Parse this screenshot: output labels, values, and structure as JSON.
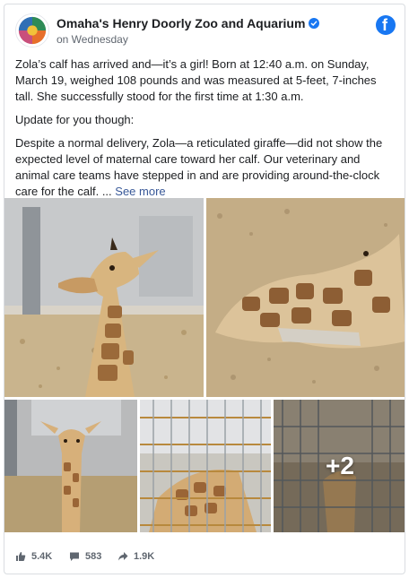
{
  "post": {
    "page_name": "Omaha's Henry Doorly Zoo and Aquarium",
    "timestamp": "on Wednesday",
    "paragraphs": [
      "Zola’s calf has arrived and—it’s a girl! Born at 12:40 a.m. on Sunday, March 19, weighed 108 pounds and was measured at 5-feet, 7-inches tall. She successfully stood for the first time at 1:30 a.m.",
      "Update for you though:"
    ],
    "last_paragraph": "Despite a normal delivery, Zola—a reticulated giraffe—did not show the expected level of maternal care toward her calf. Our veterinary and animal care teams have stepped in and are providing around-the-clock care for the calf. ... ",
    "see_more": "See more",
    "more_photos": "+2"
  },
  "stats": {
    "likes": "5.4K",
    "comments": "583",
    "shares": "1.9K"
  },
  "colors": {
    "brand_blue": "#1877f2",
    "link": "#385898",
    "muted": "#606770"
  },
  "icons": {
    "logo": "zoo-logo-icon",
    "verified": "verified-check-icon",
    "facebook": "facebook-icon",
    "like": "thumbs-up-icon",
    "comment": "comment-icon",
    "share": "share-arrow-icon"
  }
}
